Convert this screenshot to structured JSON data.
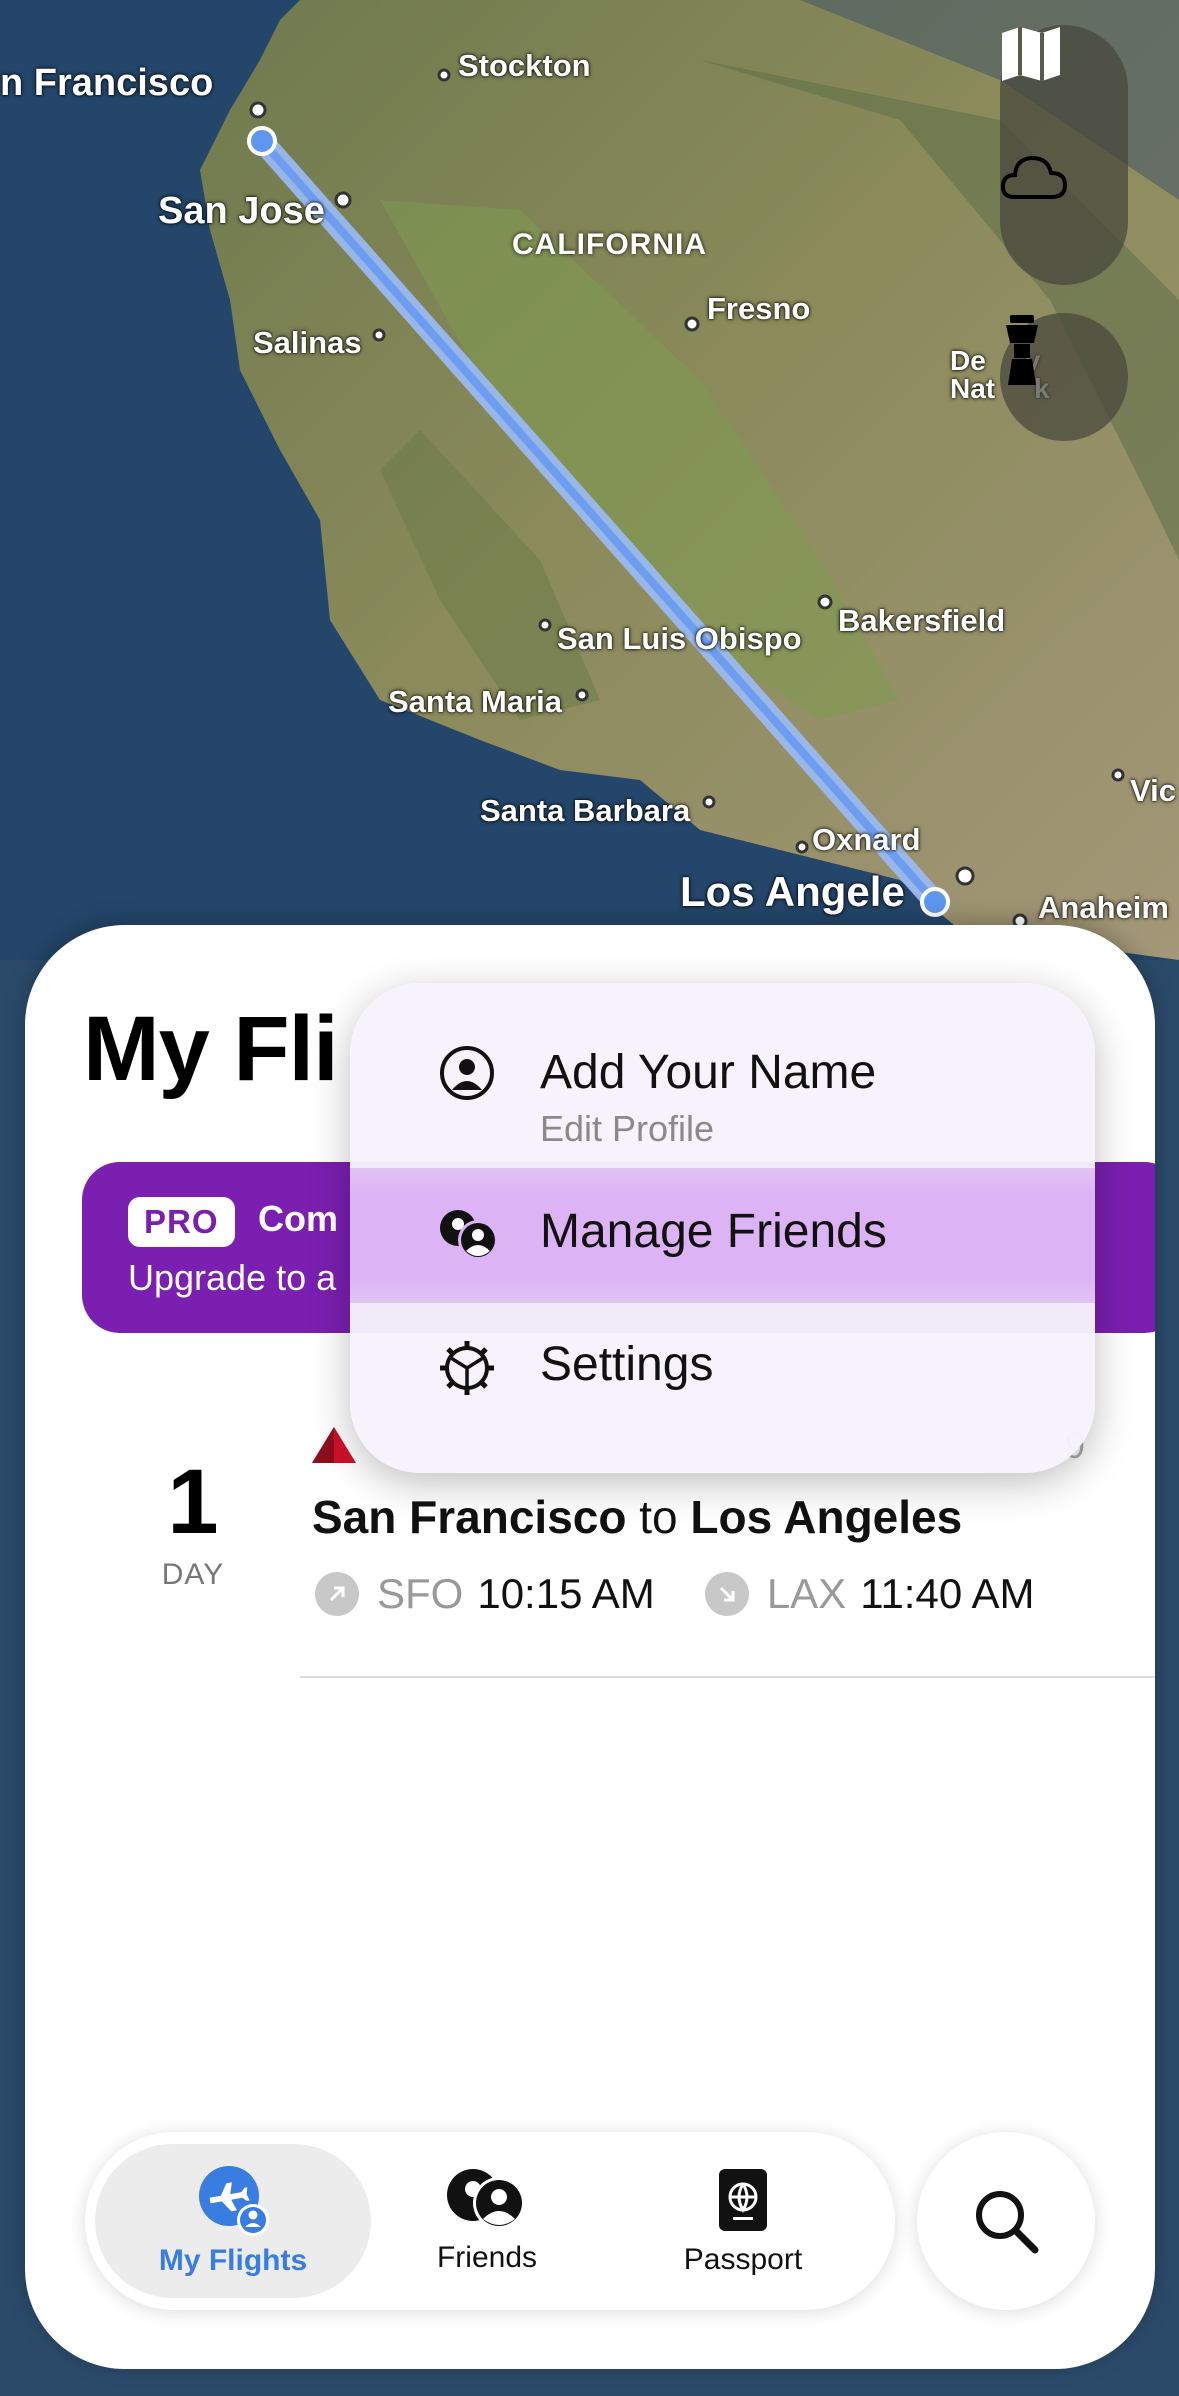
{
  "map": {
    "cities": [
      {
        "id": "san-francisco",
        "label": "n Francisco"
      },
      {
        "id": "stockton",
        "label": "Stockton"
      },
      {
        "id": "san-jose",
        "label": "San Jose"
      },
      {
        "id": "fresno",
        "label": "Fresno"
      },
      {
        "id": "salinas",
        "label": "Salinas"
      },
      {
        "id": "death-valley",
        "label": "De     y\nNat     k"
      },
      {
        "id": "san-luis-obispo",
        "label": "San Luis Obispo"
      },
      {
        "id": "bakersfield",
        "label": "Bakersfield"
      },
      {
        "id": "santa-maria",
        "label": "Santa Maria"
      },
      {
        "id": "santa-barbara",
        "label": "Santa Barbara"
      },
      {
        "id": "oxnard",
        "label": "Oxnard"
      },
      {
        "id": "los-angeles",
        "label": "Los Angele"
      },
      {
        "id": "anaheim",
        "label": "Anaheim"
      },
      {
        "id": "victorville",
        "label": "Vic"
      }
    ],
    "state_label": "CALIFORNIA",
    "route_color": "#7aa8f5",
    "controls": [
      "map-icon",
      "weather-cloud-icon",
      "airport-tower-icon"
    ]
  },
  "sheet": {
    "title": "My Fli",
    "promo": {
      "badge": "PRO",
      "title": "Com",
      "subtitle": "Upgrade to a"
    },
    "flight": {
      "day_number": "1",
      "day_label": "DAY",
      "airline": "delta-logo",
      "date_fragment": "9",
      "origin_city": "San Francisco",
      "connector": "to",
      "destination_city": "Los Angeles",
      "departure": {
        "code": "SFO",
        "time": "10:15 AM"
      },
      "arrival": {
        "code": "LAX",
        "time": "11:40 AM"
      }
    }
  },
  "menu": {
    "items": [
      {
        "title": "Add Your Name",
        "subtitle": "Edit Profile",
        "icon": "profile-circle-icon"
      },
      {
        "title": "Manage Friends",
        "icon": "friends-icon"
      },
      {
        "title": "Settings",
        "icon": "gear-icon"
      }
    ]
  },
  "tabbar": {
    "tabs": [
      {
        "label": "My Flights",
        "icon": "my-flights-icon",
        "active": true
      },
      {
        "label": "Friends",
        "icon": "friends-icon"
      },
      {
        "label": "Passport",
        "icon": "passport-icon"
      }
    ],
    "search_icon": "search-icon",
    "active_color": "#3a7de0"
  },
  "colors": {
    "promo_bg": "#7a1fb0",
    "menu_highlight": "#dcb3f5"
  }
}
